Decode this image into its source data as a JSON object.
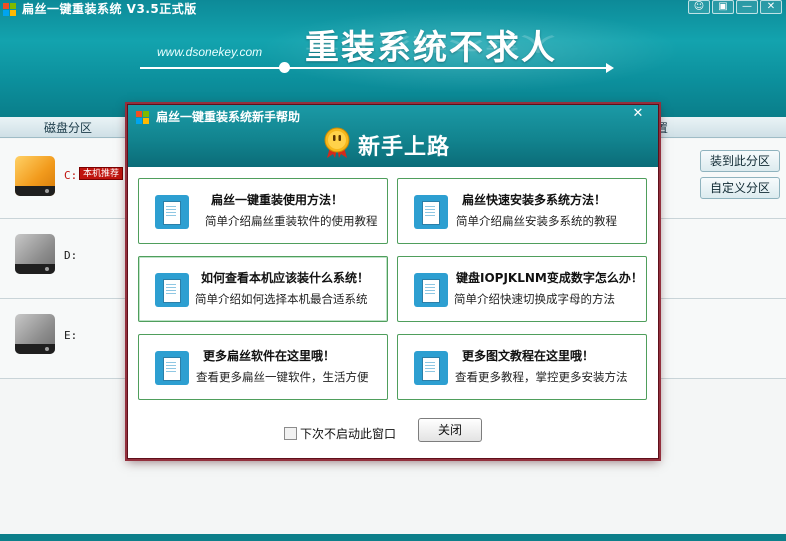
{
  "app": {
    "title": "扁丝一键重装系统 V3.5正式版",
    "window_controls": [
      "☺",
      "▣",
      "—",
      "✕"
    ],
    "site_url": "www.dsonekey.com",
    "slogan": "重装系统不求人"
  },
  "tabs": {
    "partition": "磁盘分区",
    "right": "置"
  },
  "drives": [
    {
      "letter": "C:",
      "badge": "本机推荐",
      "icon": "orange-drive-icon"
    },
    {
      "letter": "D:",
      "icon": "gray-drive-icon"
    },
    {
      "letter": "E:",
      "icon": "gray-drive-icon"
    }
  ],
  "side_buttons": {
    "install_here": "装到此分区",
    "custom_partition": "自定义分区"
  },
  "dialog": {
    "title": "扁丝一键重装系统新手帮助",
    "close": "✕",
    "heading": "新手上路",
    "cards": [
      {
        "title": "扁丝一键重装使用方法！",
        "desc": "简单介绍扁丝重装软件的使用教程"
      },
      {
        "title": "扁丝快速安装多系统方法！",
        "desc": "简单介绍扁丝安装多系统的教程"
      },
      {
        "title": "如何查看本机应该装什么系统！",
        "desc": "简单介绍如何选择本机最合适系统"
      },
      {
        "title": "键盘IOPJKLNM变成数字怎么办！",
        "desc": "简单介绍快速切换成字母的方法"
      },
      {
        "title": "更多扁丝软件在这里哦！",
        "desc": "查看更多扁丝一键软件，生活方便"
      },
      {
        "title": "更多图文教程在这里哦！",
        "desc": "查看更多教程，掌控更多安装方法"
      }
    ],
    "dont_show_again": "下次不启动此窗口",
    "close_button": "关闭"
  },
  "colors": {
    "brand_teal": "#12848f",
    "dialog_border": "#93303d",
    "card_border": "#4f9e5c",
    "badge_red": "#c0140e"
  }
}
